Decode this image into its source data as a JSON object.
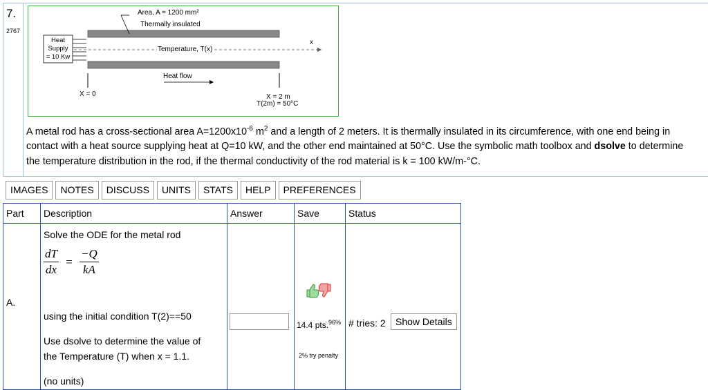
{
  "question": {
    "number": "7.",
    "id": "2767"
  },
  "figure": {
    "area_label": "Area, A = 1200 mm²",
    "insulated_label": "Thermally insulated",
    "heat_supply_lines": [
      "Heat",
      "Supply",
      "= 10 Kw"
    ],
    "temperature_label": "Temperature, T(x)",
    "x_axis_label": "x",
    "heat_flow_label": "Heat flow",
    "x0_label": "X = 0",
    "x2_label": "X = 2 m",
    "t2_label": "T(2m) = 50°C"
  },
  "description": {
    "line1_a": "A metal rod has a cross-sectional area A=1200x10",
    "line1_sup1": "-6",
    "line1_b": " m",
    "line1_sup2": "2",
    "line1_c": " and a length of 2 meters. It is thermally insulated in its circumference, with one end being in",
    "line2": "contact with a heat source supplying heat at Q=10 kW, and the other end maintained at 50°C. Use the symbolic math toolbox and ",
    "line2_bold": "dsolve",
    "line2_end": " to determine",
    "line3": "the temperature distribution in the rod, if the thermal conductivity of the rod material is k = 100 kW/m-°C."
  },
  "tabs": [
    "IMAGES",
    "NOTES",
    "DISCUSS",
    "UNITS",
    "STATS",
    "HELP",
    "PREFERENCES"
  ],
  "table": {
    "headers": {
      "part": "Part",
      "description": "Description",
      "answer": "Answer",
      "save": "Save",
      "status": "Status"
    },
    "row": {
      "part": "A.",
      "desc_intro": "Solve the ODE for the metal rod",
      "eq_lhs_num": "dT",
      "eq_lhs_den": "dx",
      "eq_eq": "=",
      "eq_rhs_num": "−Q",
      "eq_rhs_den": "kA",
      "desc_condition": "using the initial condition T(2)==50",
      "desc_task_1": "Use dsolve to determine the value of",
      "desc_task_2": "the Temperature (T) when x = 1.1.",
      "desc_units": "(no units)",
      "answer_value": "",
      "points": "14.4 pts.",
      "points_pct": "96%",
      "try_penalty": "2% try penalty",
      "tries": "# tries: 2",
      "show_details": "Show Details"
    }
  },
  "colors": {
    "frame": "#9cc3d5",
    "figure_border": "#3fae3f",
    "table_border": "#2a4fa6",
    "thumb_up": "#3a9a3a",
    "thumb_down": "#d23a3a"
  }
}
